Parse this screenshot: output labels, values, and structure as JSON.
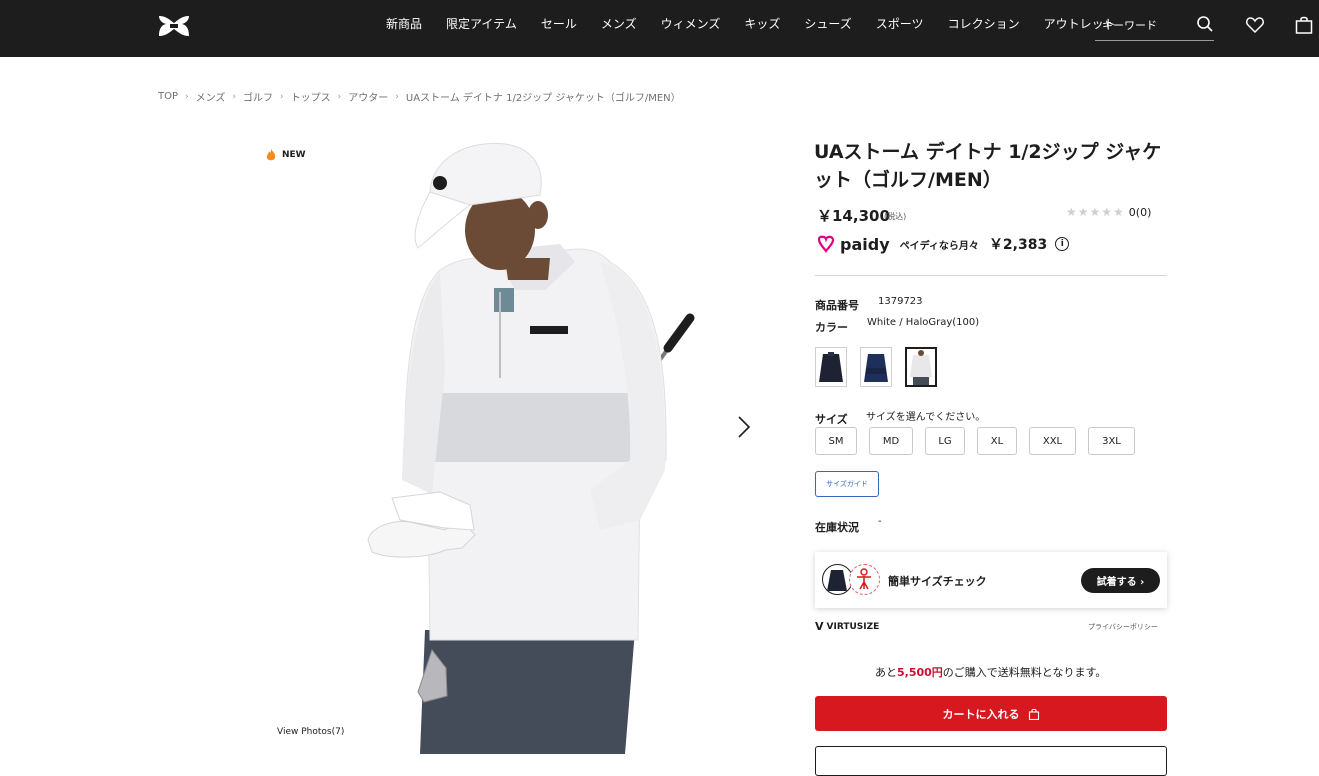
{
  "header": {
    "nav": [
      "新商品",
      "限定アイテム",
      "セール",
      "メンズ",
      "ウィメンズ",
      "キッズ",
      "シューズ",
      "スポーツ",
      "コレクション",
      "アウトレット"
    ],
    "search_placeholder": "キーワード"
  },
  "breadcrumb": [
    "TOP",
    "メンズ",
    "ゴルフ",
    "トップス",
    "アウター",
    "UAストーム デイトナ 1/2ジップ ジャケット（ゴルフ/MEN）"
  ],
  "gallery": {
    "badge": "NEW",
    "view_photos": "View Photos(7)"
  },
  "product": {
    "title": "UAストーム デイトナ 1/2ジップ ジャケット（ゴルフ/MEN）",
    "price": "￥14,300",
    "tax_note": "(税込)",
    "rating_count": "0",
    "review_count": "(0)",
    "paidy_logo": "paidy",
    "paidy_desc": "ペイディなら月々",
    "paidy_amount": "￥2,383",
    "paidy_info": "i",
    "sku_label": "商品番号",
    "sku": "1379723",
    "color_label": "カラー",
    "color_value": "White / HaloGray(100)",
    "size_label": "サイズ",
    "size_prompt": "サイズを選んでください。",
    "sizes": [
      "SM",
      "MD",
      "LG",
      "XL",
      "XXL",
      "3XL"
    ],
    "size_guide": "サイズガイド",
    "stock_label": "在庫状況",
    "stock_value": "-"
  },
  "virtusize": {
    "text": "簡単サイズチェック",
    "button": "試着する ›",
    "brand": "VIRTUSIZE",
    "brand_mark": "V",
    "privacy": "プライバシーポリシー"
  },
  "shipping": {
    "prefix": "あと",
    "amount": "5,500円",
    "suffix": "のご購入で送料無料となります。"
  },
  "cart_button": "カートに入れる",
  "colors": {
    "header_bg": "#1d1d1d",
    "accent_red": "#d7181f",
    "link_blue": "#3a66b9"
  }
}
